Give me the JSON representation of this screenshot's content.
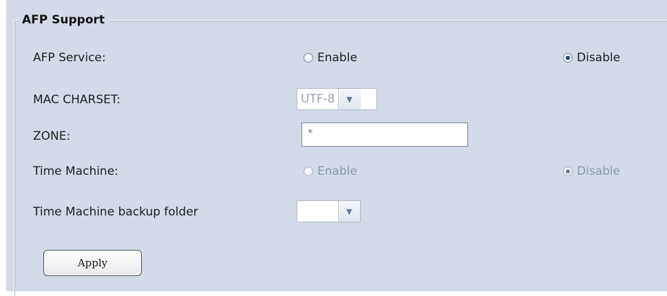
{
  "section": {
    "title": "AFP Support"
  },
  "afp_service": {
    "label": "AFP Service:",
    "enable_label": "Enable",
    "disable_label": "Disable",
    "selected": "Disable"
  },
  "mac_charset": {
    "label": "MAC CHARSET:",
    "value": "UTF-8",
    "disabled": true
  },
  "zone": {
    "label": "ZONE:",
    "value": "*"
  },
  "time_machine": {
    "label": "Time Machine:",
    "enable_label": "Enable",
    "disable_label": "Disable",
    "selected": "Disable",
    "disabled": true
  },
  "backup_folder": {
    "label": "Time Machine backup folder",
    "value": ""
  },
  "apply_label": "Apply"
}
